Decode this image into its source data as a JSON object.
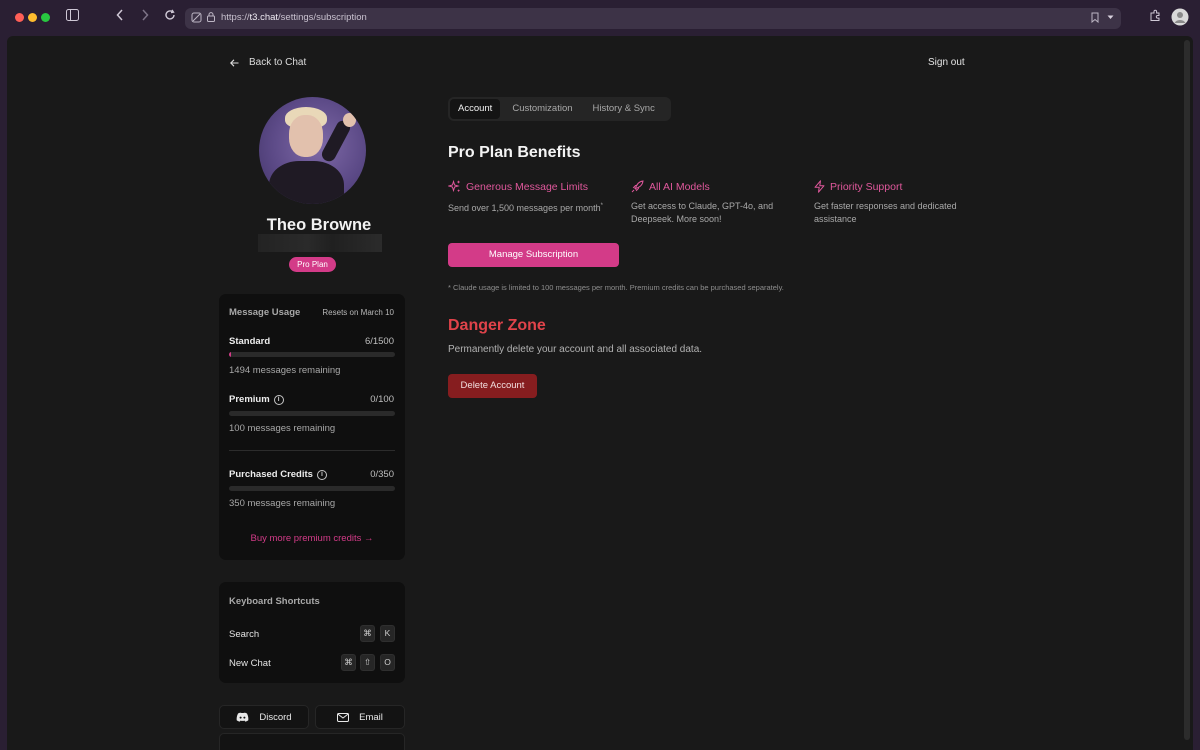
{
  "browser": {
    "url": "https://t3.chat/settings/subscription",
    "url_host": "t3.chat",
    "url_prefix": "https://",
    "url_path": "/settings/subscription"
  },
  "nav": {
    "back_label": "Back to Chat",
    "signout_label": "Sign out"
  },
  "profile": {
    "name": "Theo Browne",
    "plan_badge": "Pro Plan"
  },
  "usage": {
    "title": "Message Usage",
    "resets": "Resets on March 10",
    "rows": [
      {
        "label": "Standard",
        "value": "6/1500",
        "remaining": "1494 messages remaining",
        "fill_fraction": 0.004,
        "info": false
      },
      {
        "label": "Premium",
        "value": "0/100",
        "remaining": "100 messages remaining",
        "fill_fraction": 0,
        "info": true
      },
      {
        "label": "Purchased Credits",
        "value": "0/350",
        "remaining": "350 messages remaining",
        "fill_fraction": 0,
        "info": true
      }
    ],
    "buy_link": "Buy more premium credits →"
  },
  "shortcuts": {
    "title": "Keyboard Shortcuts",
    "items": [
      {
        "label": "Search",
        "keys": [
          "⌘",
          "K"
        ]
      },
      {
        "label": "New Chat",
        "keys": [
          "⌘",
          "⇧",
          "O"
        ]
      }
    ]
  },
  "footer": {
    "discord": "Discord",
    "email": "Email"
  },
  "tabs": [
    "Account",
    "Customization",
    "History & Sync"
  ],
  "active_tab": "Account",
  "pro": {
    "title": "Pro Plan Benefits",
    "benefits": [
      {
        "icon": "sparkles-icon",
        "title": "Generous Message Limits",
        "desc": "Send over 1,500 messages per month",
        "sup": "*"
      },
      {
        "icon": "rocket-icon",
        "title": "All AI Models",
        "desc": "Get access to Claude, GPT-4o, and Deepseek. More soon!",
        "sup": ""
      },
      {
        "icon": "lightning-icon",
        "title": "Priority Support",
        "desc": "Get faster responses and dedicated assistance",
        "sup": ""
      }
    ],
    "manage_button": "Manage Subscription",
    "footnote": "* Claude usage is limited to 100 messages per month. Premium credits can be purchased separately."
  },
  "danger": {
    "title": "Danger Zone",
    "desc": "Permanently delete your account and all associated data.",
    "button": "Delete Account"
  },
  "colors": {
    "accent": "#d33b88",
    "danger": "#e0434a",
    "danger_button": "#861d1f",
    "background": "#191919"
  }
}
